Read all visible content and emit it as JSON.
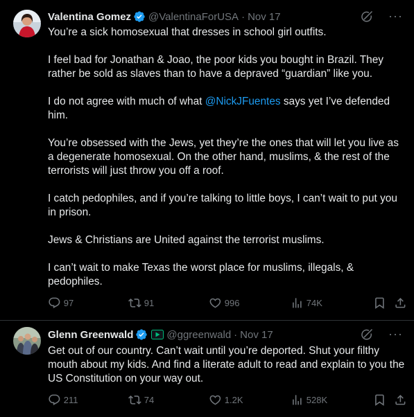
{
  "tweets": [
    {
      "author": {
        "name": "Valentina Gomez",
        "handle": "@ValentinaForUSA",
        "date": "Nov 17"
      },
      "paragraphs": [
        {
          "text": "You’re a sick homosexual that dresses in school girl outfits."
        },
        {
          "text": "I feel bad for Jonathan & Joao, the poor kids you bought in Brazil. They rather be sold as slaves than to have a depraved “guardian” like you."
        },
        {
          "pre": "I do not agree with much of what ",
          "mention": "@NickJFuentes",
          "post": " says yet I’ve defended him."
        },
        {
          "text": "You’re obsessed with the Jews, yet they’re the ones that will let you live as a degenerate homosexual. On the other hand, muslims, & the rest of the terrorists will just throw you off a roof."
        },
        {
          "text": "I catch pedophiles, and if you’re talking to little boys, I can’t wait to put you in prison."
        },
        {
          "text": "Jews & Christians are United against the terrorist muslims."
        },
        {
          "text": "I can’t wait to make Texas the worst place for muslims, illegals, & pedophiles."
        }
      ],
      "stats": {
        "replies": "97",
        "reposts": "91",
        "likes": "996",
        "views": "74K"
      }
    },
    {
      "author": {
        "name": "Glenn Greenwald",
        "handle": "@ggreenwald",
        "date": "Nov 17"
      },
      "paragraphs": [
        {
          "text": "Get out of our country. Can’t wait until you’re deported. Shut your filthy mouth about my kids. And find a literate adult to read and explain to you the US Constitution on your way out."
        }
      ],
      "stats": {
        "replies": "211",
        "reposts": "74",
        "likes": "1.2K",
        "views": "528K"
      }
    }
  ],
  "icons": [
    "verified-badge-icon",
    "grok-icon",
    "more-icon",
    "reply-icon",
    "repost-icon",
    "like-icon",
    "views-icon",
    "bookmark-icon",
    "share-icon",
    "affiliate-badge-icon"
  ],
  "colors": {
    "background": "#000000",
    "text": "#e7e9ea",
    "muted": "#71767b",
    "link": "#1d9bf0",
    "verified": "#1d9bf0",
    "divider": "#2f3336",
    "affiliate": "#00ba7c"
  },
  "dot": "·"
}
